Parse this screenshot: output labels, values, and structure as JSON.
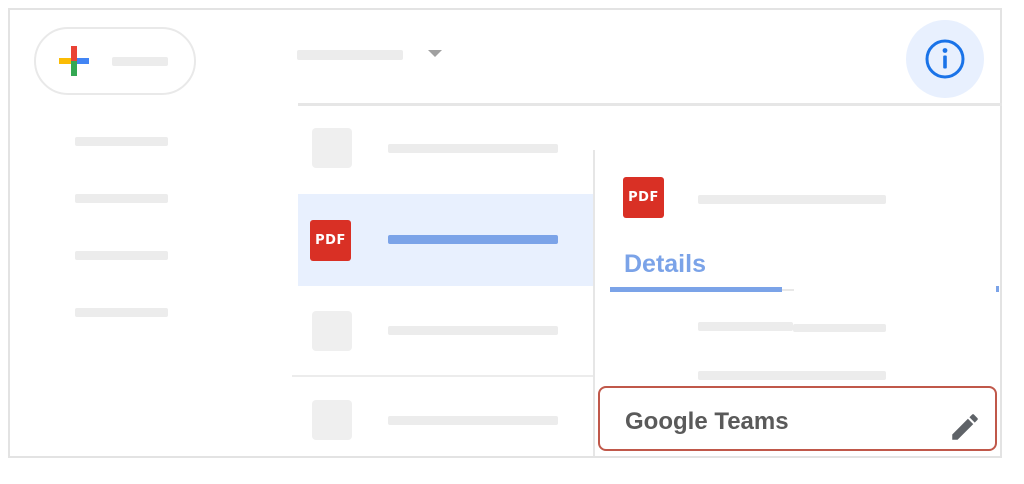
{
  "new_button": {
    "icon": "plus-color-icon"
  },
  "toolbar": {
    "info_icon": "info-icon",
    "dropdown_icon": "caret-down-icon"
  },
  "file_list": {
    "selected_file": {
      "type_badge": "PDF"
    }
  },
  "details_panel": {
    "file_type_badge": "PDF",
    "tab_label": "Details",
    "team_field": {
      "value": "Google Teams",
      "edit_icon": "pencil-icon"
    }
  },
  "colors": {
    "accent": "#7ba3e8",
    "pdf_red": "#d93025",
    "selected_row_bg": "#e8f0fe",
    "highlight_border": "#c0584a",
    "info_blue": "#1a73e8"
  }
}
